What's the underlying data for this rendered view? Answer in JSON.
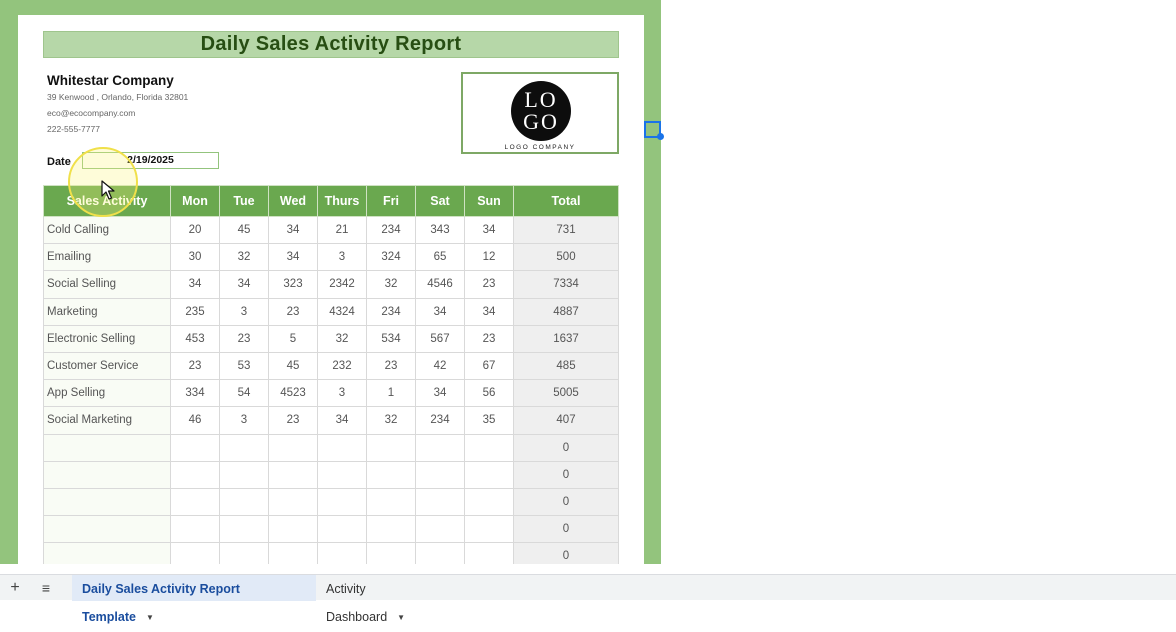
{
  "report": {
    "title": "Daily Sales Activity Report",
    "company": {
      "name": "Whitestar Company",
      "address": "39 Kenwood , Orlando, Florida 32801",
      "email": "eco@ecocompany.com",
      "phone": "222-555-7777"
    },
    "logo": {
      "line1": "LO",
      "line2": "GO",
      "caption": "LOGO COMPANY"
    },
    "date_label": "Date",
    "date_value": "2/19/2025",
    "table": {
      "headers": [
        "Sales Activity",
        "Mon",
        "Tue",
        "Wed",
        "Thurs",
        "Fri",
        "Sat",
        "Sun",
        "Total"
      ],
      "rows": [
        [
          "Cold Calling",
          "20",
          "45",
          "34",
          "21",
          "234",
          "343",
          "34",
          "731"
        ],
        [
          "Emailing",
          "30",
          "32",
          "34",
          "3",
          "324",
          "65",
          "12",
          "500"
        ],
        [
          "Social Selling",
          "34",
          "34",
          "323",
          "2342",
          "32",
          "4546",
          "23",
          "7334"
        ],
        [
          "Marketing",
          "235",
          "3",
          "23",
          "4324",
          "234",
          "34",
          "34",
          "4887"
        ],
        [
          "Electronic Selling",
          "453",
          "23",
          "5",
          "32",
          "534",
          "567",
          "23",
          "1637"
        ],
        [
          "Customer Service",
          "23",
          "53",
          "45",
          "232",
          "23",
          "42",
          "67",
          "485"
        ],
        [
          "App Selling",
          "334",
          "54",
          "4523",
          "3",
          "1",
          "34",
          "56",
          "5005"
        ],
        [
          "Social Marketing",
          "46",
          "3",
          "23",
          "34",
          "32",
          "234",
          "35",
          "407"
        ],
        [
          "",
          "",
          "",
          "",
          "",
          "",
          "",
          "",
          "0"
        ],
        [
          "",
          "",
          "",
          "",
          "",
          "",
          "",
          "",
          "0"
        ],
        [
          "",
          "",
          "",
          "",
          "",
          "",
          "",
          "",
          "0"
        ],
        [
          "",
          "",
          "",
          "",
          "",
          "",
          "",
          "",
          "0"
        ],
        [
          "",
          "",
          "",
          "",
          "",
          "",
          "",
          "",
          "0"
        ]
      ]
    }
  },
  "sheet_tabs": {
    "add_icon": "+",
    "all_sheets_icon": "≡",
    "tabs": [
      {
        "label": "Daily Sales Activity Report Template",
        "active": true
      },
      {
        "label": "Activity Dashboard",
        "active": false
      }
    ]
  },
  "colors": {
    "frame_green": "#93c47d",
    "header_green": "#6aa84f",
    "title_fill": "#b6d7a8",
    "title_text": "#274e13",
    "selection_blue": "#1a73e8"
  }
}
